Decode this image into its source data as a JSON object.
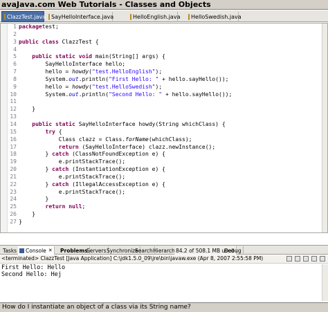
{
  "window": {
    "title": "avaJava.com Web Tutorials - Classes and Objects"
  },
  "editor_tabs": [
    {
      "label": "ClazzTest.java",
      "active": true
    },
    {
      "label": "SayHelloInterface.java",
      "active": false
    },
    {
      "label": "HelloEnglish.java",
      "active": false
    },
    {
      "label": "HelloSwedish.java",
      "active": false
    }
  ],
  "code_lines": [
    {
      "n": "1",
      "segs": [
        [
          "kw",
          "package"
        ],
        [
          "",
          "test;"
        ]
      ]
    },
    {
      "n": "2",
      "segs": []
    },
    {
      "n": "3",
      "segs": [
        [
          "kw",
          "public class"
        ],
        [
          "",
          " ClazzTest {"
        ]
      ]
    },
    {
      "n": "4",
      "segs": []
    },
    {
      "n": "5",
      "segs": [
        [
          "",
          "    "
        ],
        [
          "kw",
          "public static void"
        ],
        [
          "",
          " main(String[] args) {"
        ]
      ]
    },
    {
      "n": "6",
      "segs": [
        [
          "",
          "        SayHelloInterface hello;"
        ]
      ]
    },
    {
      "n": "7",
      "segs": [
        [
          "",
          "        hello = "
        ],
        [
          "itl",
          "howdy"
        ],
        [
          "",
          "("
        ],
        [
          "str",
          "\"test.HelloEnglish\""
        ],
        [
          "",
          ");"
        ]
      ]
    },
    {
      "n": "8",
      "segs": [
        [
          "",
          "        System."
        ],
        [
          "fld",
          "out"
        ],
        [
          "",
          ".println("
        ],
        [
          "str",
          "\"First Hello: \""
        ],
        [
          "",
          " + hello.sayHello());"
        ]
      ]
    },
    {
      "n": "9",
      "segs": [
        [
          "",
          "        hello = "
        ],
        [
          "itl",
          "howdy"
        ],
        [
          "",
          "("
        ],
        [
          "str",
          "\"test.HelloSwedish\""
        ],
        [
          "",
          ");"
        ]
      ]
    },
    {
      "n": "10",
      "segs": [
        [
          "",
          "        System."
        ],
        [
          "fld",
          "out"
        ],
        [
          "",
          ".println("
        ],
        [
          "str",
          "\"Second Hello: \""
        ],
        [
          "",
          " + hello.sayHello());"
        ]
      ]
    },
    {
      "n": "11",
      "segs": []
    },
    {
      "n": "12",
      "segs": [
        [
          "",
          "    }"
        ]
      ]
    },
    {
      "n": "13",
      "segs": []
    },
    {
      "n": "14",
      "segs": [
        [
          "",
          "    "
        ],
        [
          "kw",
          "public static"
        ],
        [
          "",
          " SayHelloInterface howdy(String whichClass) {"
        ]
      ]
    },
    {
      "n": "15",
      "segs": [
        [
          "",
          "        "
        ],
        [
          "kw",
          "try"
        ],
        [
          "",
          " {"
        ]
      ]
    },
    {
      "n": "16",
      "segs": [
        [
          "",
          "            Class clazz = Class."
        ],
        [
          "itl",
          "forName"
        ],
        [
          "",
          "(whichClass);"
        ]
      ]
    },
    {
      "n": "17",
      "segs": [
        [
          "",
          "            "
        ],
        [
          "kw",
          "return"
        ],
        [
          "",
          " (SayHelloInterface) clazz.newInstance();"
        ]
      ]
    },
    {
      "n": "18",
      "segs": [
        [
          "",
          "        } "
        ],
        [
          "kw",
          "catch"
        ],
        [
          "",
          " (ClassNotFoundException e) {"
        ]
      ]
    },
    {
      "n": "19",
      "segs": [
        [
          "",
          "            e.printStackTrace();"
        ]
      ]
    },
    {
      "n": "20",
      "segs": [
        [
          "",
          "        } "
        ],
        [
          "kw",
          "catch"
        ],
        [
          "",
          " (InstantiationException e) {"
        ]
      ]
    },
    {
      "n": "21",
      "segs": [
        [
          "",
          "            e.printStackTrace();"
        ]
      ]
    },
    {
      "n": "22",
      "segs": [
        [
          "",
          "        } "
        ],
        [
          "kw",
          "catch"
        ],
        [
          "",
          " (IllegalAccessException e) {"
        ]
      ]
    },
    {
      "n": "23",
      "segs": [
        [
          "",
          "            e.printStackTrace();"
        ]
      ]
    },
    {
      "n": "24",
      "segs": [
        [
          "",
          "        }"
        ]
      ]
    },
    {
      "n": "25",
      "segs": [
        [
          "",
          "        "
        ],
        [
          "kw",
          "return null"
        ],
        [
          "",
          ";"
        ]
      ]
    },
    {
      "n": "26",
      "segs": [
        [
          "",
          "    }"
        ]
      ]
    },
    {
      "n": "27",
      "segs": [
        [
          "",
          "}"
        ]
      ]
    }
  ],
  "view_tabs": [
    {
      "label": "Tasks",
      "style": ""
    },
    {
      "label": "Console",
      "style": "active"
    },
    {
      "label": "Problems",
      "style": "bold"
    },
    {
      "label": "Servers",
      "style": ""
    },
    {
      "label": "Synchronize",
      "style": ""
    },
    {
      "label": "Search",
      "style": ""
    },
    {
      "label": "Hierarchy",
      "style": ""
    },
    {
      "label": "84.2 of 508.1 MB used",
      "style": ""
    },
    {
      "label": "Debug",
      "style": ""
    }
  ],
  "console": {
    "header": "<terminated> ClazzTest [Java Application] C:\\jdk1.5.0_09\\jre\\bin\\javaw.exe (Apr 8, 2007 2:55:58 PM)",
    "lines": [
      "First Hello: Hello",
      "Second Hello: Hej"
    ]
  },
  "caption": "How do I instantiate an object of a class via its String name?",
  "colors": {
    "keyword": "#7f0055",
    "string": "#2a00ff",
    "field": "#0000c0",
    "active_tab": "#4a6fa5"
  }
}
